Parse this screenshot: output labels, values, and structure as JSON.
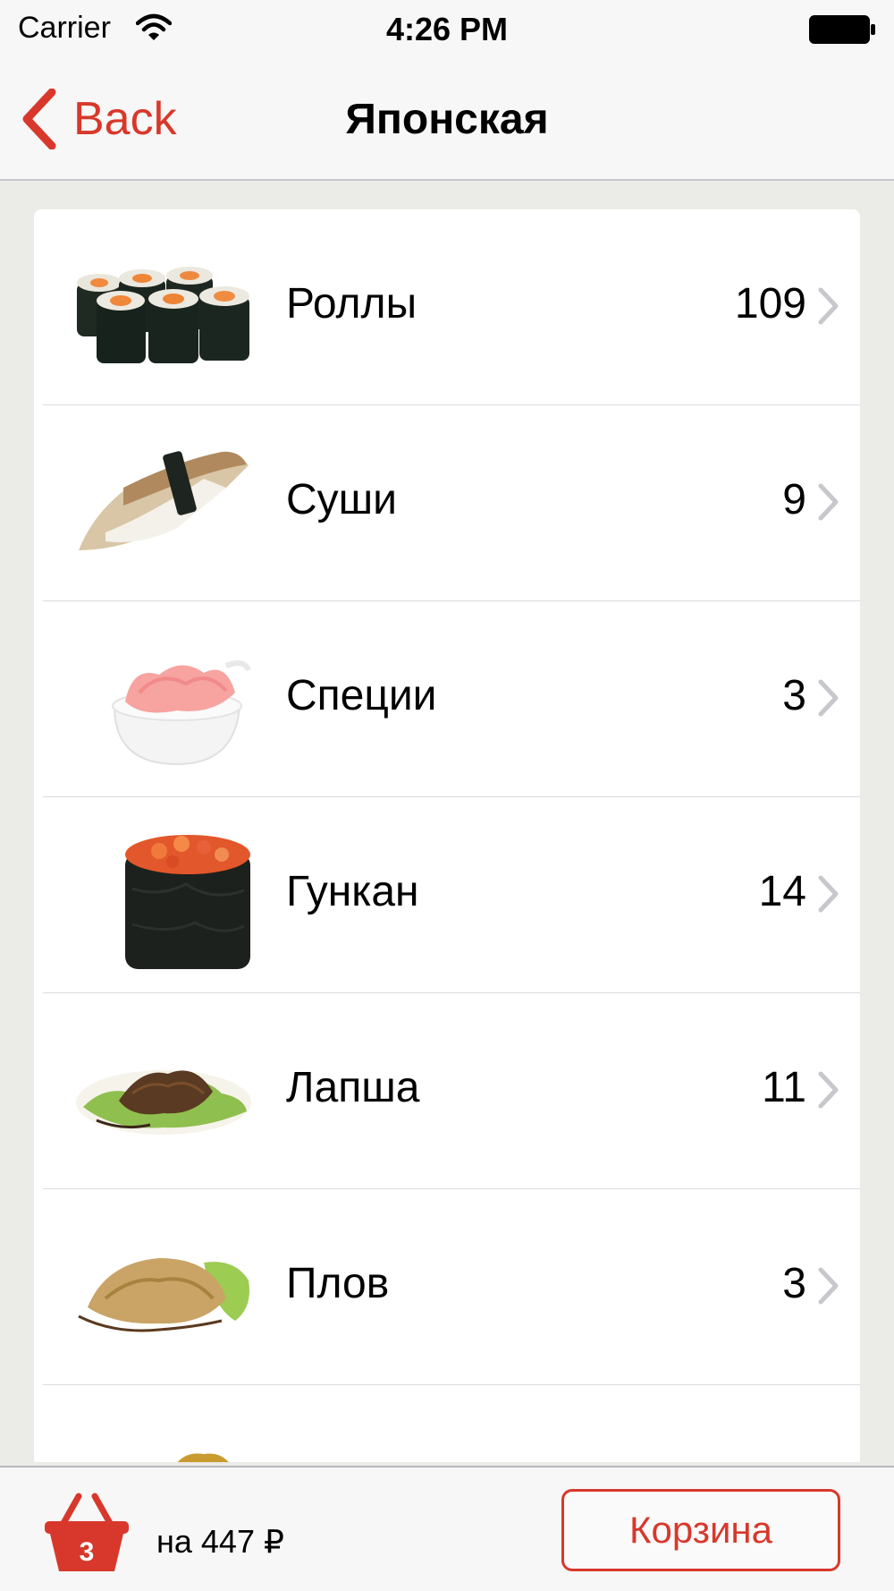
{
  "status_bar": {
    "carrier": "Carrier",
    "time": "4:26 PM",
    "wifi_icon": "wifi-icon",
    "battery_icon": "battery-icon"
  },
  "nav": {
    "back_label": "Back",
    "title": "Японская"
  },
  "categories": [
    {
      "label": "Роллы",
      "count": "109",
      "icon": "rolls-photo"
    },
    {
      "label": "Суши",
      "count": "9",
      "icon": "sushi-photo"
    },
    {
      "label": "Специи",
      "count": "3",
      "icon": "ginger-photo"
    },
    {
      "label": "Гункан",
      "count": "14",
      "icon": "gunkan-photo"
    },
    {
      "label": "Лапша",
      "count": "11",
      "icon": "noodles-photo"
    },
    {
      "label": "Плов",
      "count": "3",
      "icon": "pilaf-photo"
    },
    {
      "label": "",
      "count": "",
      "icon": "tempura-photo"
    }
  ],
  "bottom_bar": {
    "basket_count": "3",
    "total": "на 447 ₽",
    "cart_button_label": "Корзина"
  },
  "colors": {
    "accent": "#d8382b",
    "background": "#ebebe7",
    "bar": "#f7f7f7"
  }
}
